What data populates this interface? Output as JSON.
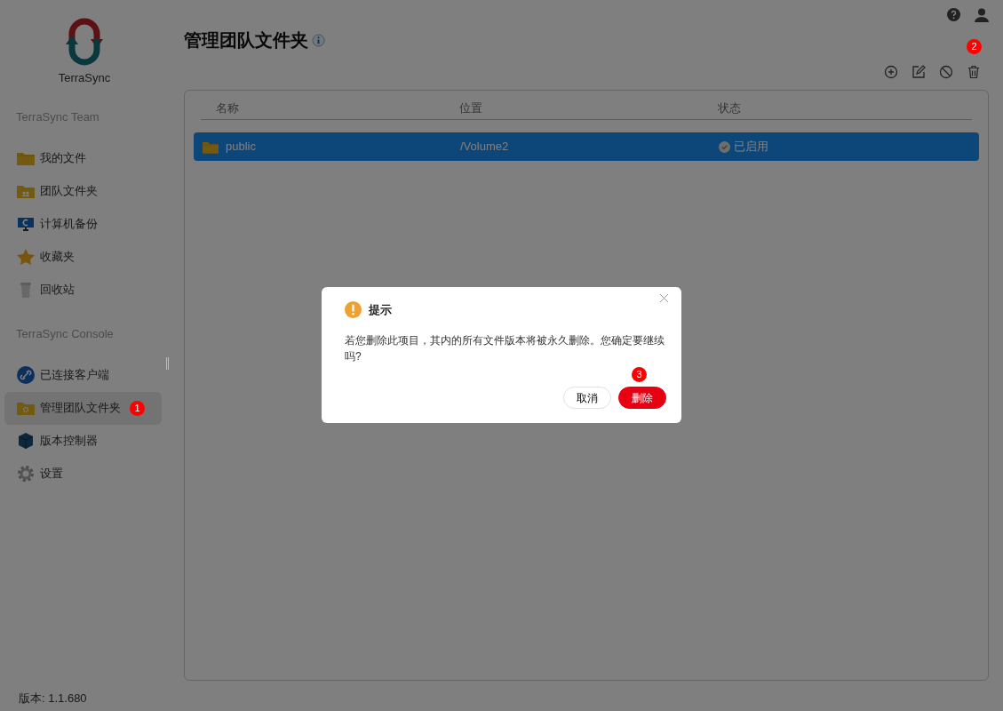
{
  "app": {
    "name": "TerraSync"
  },
  "sidebar": {
    "sections": [
      {
        "heading": "TerraSync Team",
        "items": [
          {
            "label": "我的文件",
            "kind": "folder",
            "selected": false
          },
          {
            "label": "团队文件夹",
            "kind": "team-folder",
            "selected": false
          },
          {
            "label": "计算机备份",
            "kind": "computer",
            "selected": false
          },
          {
            "label": "收藏夹",
            "kind": "star",
            "selected": false
          },
          {
            "label": "回收站",
            "kind": "bin",
            "selected": false
          }
        ]
      },
      {
        "heading": "TerraSync Console",
        "items": [
          {
            "label": "已连接客户端",
            "kind": "link",
            "selected": false
          },
          {
            "label": "管理团队文件夹",
            "kind": "gear-folder",
            "selected": true,
            "marker": "1"
          },
          {
            "label": "版本控制器",
            "kind": "cube",
            "selected": false
          },
          {
            "label": "设置",
            "kind": "gear",
            "selected": false
          }
        ]
      }
    ]
  },
  "version": "版本: 1.1.680",
  "page": {
    "title": "管理团队文件夹"
  },
  "toolbar": [
    {
      "kind": "add"
    },
    {
      "kind": "edit"
    },
    {
      "kind": "disable"
    },
    {
      "kind": "delete",
      "marker": "2"
    }
  ],
  "table": {
    "columns": [
      "名称",
      "位置",
      "状态"
    ],
    "rows": [
      {
        "name": "public",
        "location": "/Volume2",
        "status": "已启用",
        "selected": true
      }
    ]
  },
  "dialog": {
    "title": "提示",
    "message": "若您删除此项目，其内的所有文件版本将被永久删除。您确定要继续吗?",
    "buttons": [
      {
        "label": "取消",
        "kind": "secondary"
      },
      {
        "label": "删除",
        "kind": "danger",
        "marker": "3"
      }
    ]
  }
}
